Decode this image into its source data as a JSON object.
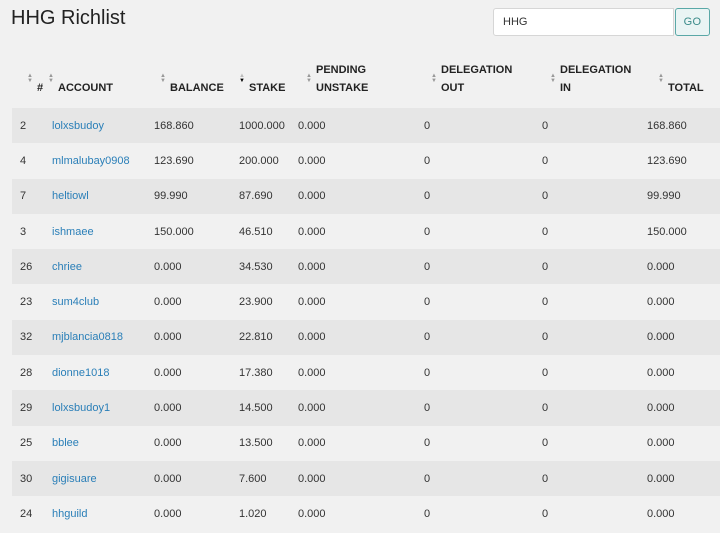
{
  "page": {
    "title": "HHG Richlist"
  },
  "search": {
    "value": "HHG",
    "go_label": "GO"
  },
  "table": {
    "columns": [
      {
        "key": "rank",
        "label1": "",
        "label2": "#"
      },
      {
        "key": "account",
        "label1": "",
        "label2": "ACCOUNT"
      },
      {
        "key": "balance",
        "label1": "",
        "label2": "BALANCE"
      },
      {
        "key": "stake",
        "label1": "",
        "label2": "STAKE",
        "sorted": "desc"
      },
      {
        "key": "pending_unstake",
        "label1": "PENDING",
        "label2": "UNSTAKE"
      },
      {
        "key": "delegation_out",
        "label1": "DELEGATION",
        "label2": "OUT"
      },
      {
        "key": "delegation_in",
        "label1": "DELEGATION",
        "label2": "IN"
      },
      {
        "key": "total",
        "label1": "",
        "label2": "TOTAL"
      }
    ],
    "rows": [
      {
        "rank": "2",
        "account": "lolxsbudoy",
        "balance": "168.860",
        "stake": "1000.000",
        "pending_unstake": "0.000",
        "delegation_out": "0",
        "delegation_in": "0",
        "total": "168.860"
      },
      {
        "rank": "4",
        "account": "mlmalubay0908",
        "balance": "123.690",
        "stake": "200.000",
        "pending_unstake": "0.000",
        "delegation_out": "0",
        "delegation_in": "0",
        "total": "123.690"
      },
      {
        "rank": "7",
        "account": "heltiowl",
        "balance": "99.990",
        "stake": "87.690",
        "pending_unstake": "0.000",
        "delegation_out": "0",
        "delegation_in": "0",
        "total": "99.990"
      },
      {
        "rank": "3",
        "account": "ishmaee",
        "balance": "150.000",
        "stake": "46.510",
        "pending_unstake": "0.000",
        "delegation_out": "0",
        "delegation_in": "0",
        "total": "150.000"
      },
      {
        "rank": "26",
        "account": "chriee",
        "balance": "0.000",
        "stake": "34.530",
        "pending_unstake": "0.000",
        "delegation_out": "0",
        "delegation_in": "0",
        "total": "0.000"
      },
      {
        "rank": "23",
        "account": "sum4club",
        "balance": "0.000",
        "stake": "23.900",
        "pending_unstake": "0.000",
        "delegation_out": "0",
        "delegation_in": "0",
        "total": "0.000"
      },
      {
        "rank": "32",
        "account": "mjblancia0818",
        "balance": "0.000",
        "stake": "22.810",
        "pending_unstake": "0.000",
        "delegation_out": "0",
        "delegation_in": "0",
        "total": "0.000"
      },
      {
        "rank": "28",
        "account": "dionne1018",
        "balance": "0.000",
        "stake": "17.380",
        "pending_unstake": "0.000",
        "delegation_out": "0",
        "delegation_in": "0",
        "total": "0.000"
      },
      {
        "rank": "29",
        "account": "lolxsbudoy1",
        "balance": "0.000",
        "stake": "14.500",
        "pending_unstake": "0.000",
        "delegation_out": "0",
        "delegation_in": "0",
        "total": "0.000"
      },
      {
        "rank": "25",
        "account": "bblee",
        "balance": "0.000",
        "stake": "13.500",
        "pending_unstake": "0.000",
        "delegation_out": "0",
        "delegation_in": "0",
        "total": "0.000"
      },
      {
        "rank": "30",
        "account": "gigisuare",
        "balance": "0.000",
        "stake": "7.600",
        "pending_unstake": "0.000",
        "delegation_out": "0",
        "delegation_in": "0",
        "total": "0.000"
      },
      {
        "rank": "24",
        "account": "hhguild",
        "balance": "0.000",
        "stake": "1.020",
        "pending_unstake": "0.000",
        "delegation_out": "0",
        "delegation_in": "0",
        "total": "0.000"
      }
    ]
  },
  "icons": {
    "sort": "sort-updown-icon",
    "sort_desc": "sort-desc-icon"
  },
  "colors": {
    "link": "#2a7fb8",
    "go_border": "#5aa8a7",
    "row_odd": "#e6e6e6",
    "row_even": "#f1f1f1"
  }
}
